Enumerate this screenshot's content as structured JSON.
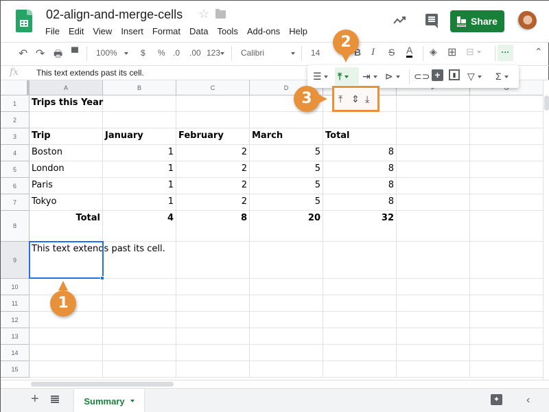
{
  "app": {
    "doc_title": "02-align-and-merge-cells",
    "menu": [
      "File",
      "Edit",
      "View",
      "Insert",
      "Format",
      "Data",
      "Tools",
      "Add-ons",
      "Help"
    ],
    "share_label": "Share",
    "brand_color": "#188038",
    "accent_color": "#1a73e8",
    "callout_color": "#e8913b"
  },
  "toolbar": {
    "zoom": "100%",
    "currency": "$",
    "percent": "%",
    "decrease_decimal": ".0",
    "increase_decimal": ".00",
    "more_formats": "123",
    "font": "Calibri",
    "font_size": "14",
    "bold": "B",
    "italic": "I",
    "strike": "S",
    "text_color": "A",
    "more": "···",
    "collapse": "^"
  },
  "formula_bar": {
    "fx_label": "fx",
    "value": "This text extends past its cell."
  },
  "sheet": {
    "columns": [
      "A",
      "B",
      "C",
      "D",
      "E",
      "F",
      "G"
    ],
    "rows": [
      "1",
      "2",
      "3",
      "4",
      "5",
      "6",
      "7",
      "8",
      "9",
      "10",
      "11",
      "12",
      "13",
      "14",
      "15"
    ],
    "cells": {
      "title": "Trips this Year",
      "headers": [
        "Trip",
        "January",
        "February",
        "March",
        "Total"
      ],
      "data": [
        [
          "Boston",
          "1",
          "2",
          "5",
          "8"
        ],
        [
          "London",
          "1",
          "2",
          "5",
          "8"
        ],
        [
          "Paris",
          "1",
          "2",
          "5",
          "8"
        ],
        [
          "Tokyo",
          "1",
          "2",
          "5",
          "8"
        ]
      ],
      "totals": [
        "Total",
        "4",
        "8",
        "20",
        "32"
      ],
      "a9": "This text extends past its cell."
    },
    "selected_cell": "A9"
  },
  "bottom_bar": {
    "add_sheet": "+",
    "sheet_tab": "Summary"
  },
  "callouts": [
    "1",
    "2",
    "3"
  ]
}
